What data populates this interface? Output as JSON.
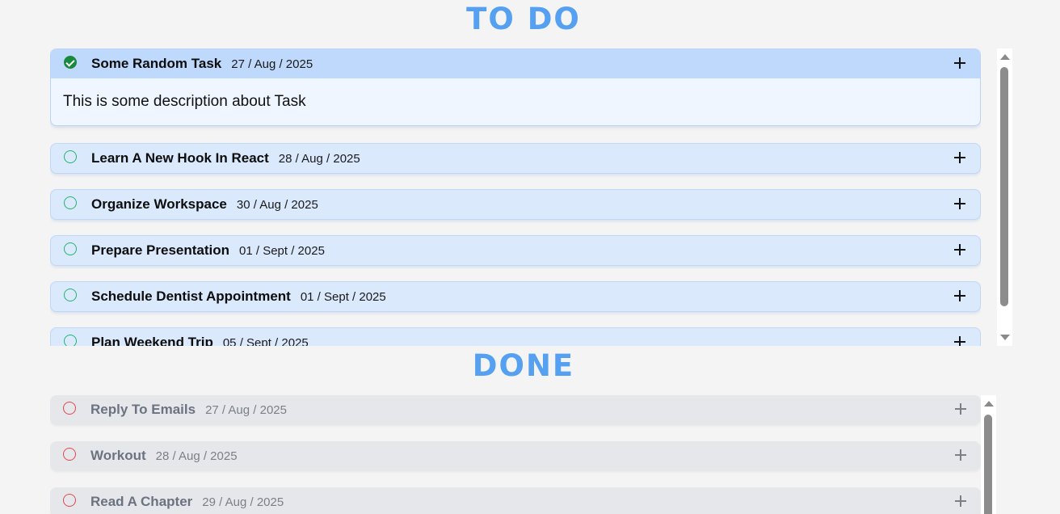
{
  "todo": {
    "title": "TO DO",
    "tasks": [
      {
        "name": "Some Random Task",
        "date": "27 / Aug / 2025",
        "expanded": true,
        "status": "checked",
        "description": "This is some description about Task"
      },
      {
        "name": "Learn A New Hook In React",
        "date": "28 / Aug / 2025",
        "status": "open"
      },
      {
        "name": "Organize Workspace",
        "date": "30 / Aug / 2025",
        "status": "open"
      },
      {
        "name": "Prepare Presentation",
        "date": "01 / Sept / 2025",
        "status": "open"
      },
      {
        "name": "Schedule Dentist Appointment",
        "date": "01 / Sept / 2025",
        "status": "open"
      },
      {
        "name": "Plan Weekend Trip",
        "date": "05 / Sept / 2025",
        "status": "open"
      }
    ]
  },
  "done": {
    "title": "DONE",
    "tasks": [
      {
        "name": "Reply To Emails",
        "date": "27 / Aug / 2025"
      },
      {
        "name": "Workout",
        "date": "28 / Aug / 2025"
      },
      {
        "name": "Read A Chapter",
        "date": "29 / Aug / 2025"
      }
    ]
  },
  "icons": {
    "status_checked": "check-circle-icon",
    "status_open": "circle-icon",
    "expand": "plus-icon"
  },
  "colors": {
    "title": "#55a0f0",
    "todo_item_bg": "#dbe9fd",
    "todo_item_expanded_header": "#bed9fc",
    "done_item_bg": "#e6e7ea",
    "todo_circle": "#22b46a",
    "done_circle": "#e2474f",
    "checked_circle": "#178a3c"
  }
}
